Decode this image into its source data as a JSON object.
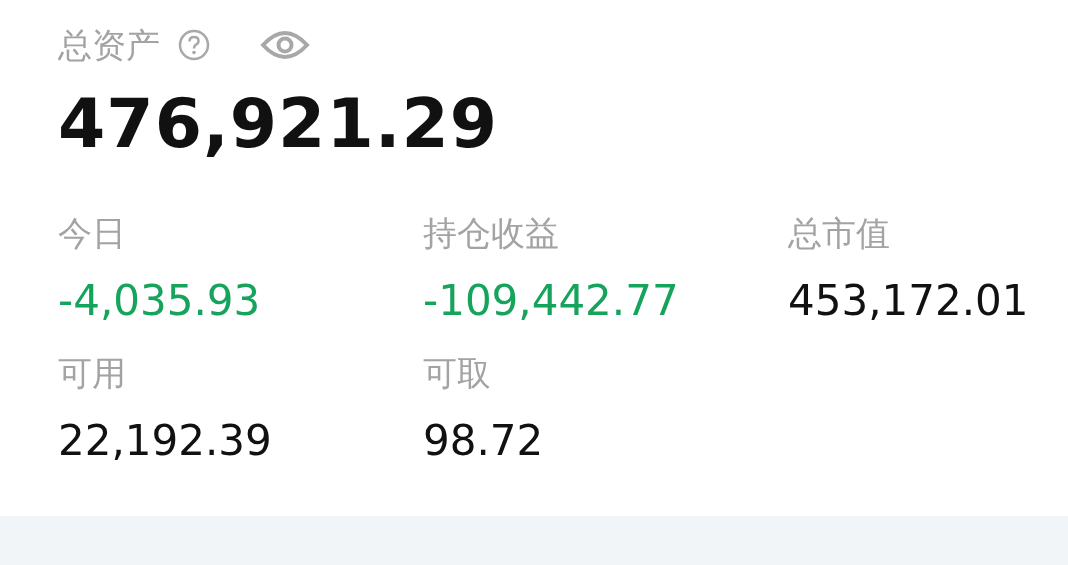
{
  "total": {
    "label": "总资产",
    "value": "476,921.29"
  },
  "stats": [
    {
      "label": "今日",
      "value": "-4,035.93",
      "color": "#16a35c"
    },
    {
      "label": "持仓收益",
      "value": "-109,442.77",
      "color": "#16a35c"
    },
    {
      "label": "总市值",
      "value": "453,172.01",
      "color": "#111111"
    },
    {
      "label": "可用",
      "value": "22,192.39",
      "color": "#111111"
    },
    {
      "label": "可取",
      "value": "98.72",
      "color": "#111111"
    }
  ]
}
